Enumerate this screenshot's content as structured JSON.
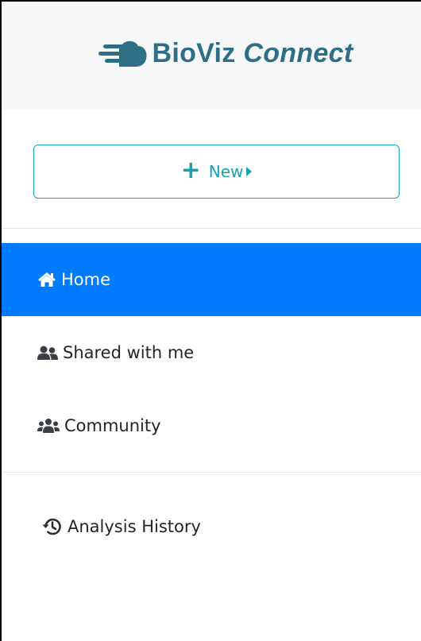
{
  "brand": {
    "name_bold": "BioViz",
    "name_italic": "Connect",
    "color": "#2e6f86"
  },
  "actions": {
    "new_label": "New",
    "new_icon": "plus-icon",
    "caret_icon": "caret-right-icon",
    "accent": "#17a2b8"
  },
  "nav": {
    "items": [
      {
        "label": "Home",
        "icon": "home-icon",
        "active": true
      },
      {
        "label": "Shared with me",
        "icon": "user-friends-icon",
        "active": false
      },
      {
        "label": "Community",
        "icon": "users-icon",
        "active": false
      }
    ],
    "secondary": [
      {
        "label": "Analysis History",
        "icon": "history-icon",
        "active": false
      }
    ],
    "active_color": "#007bff"
  }
}
